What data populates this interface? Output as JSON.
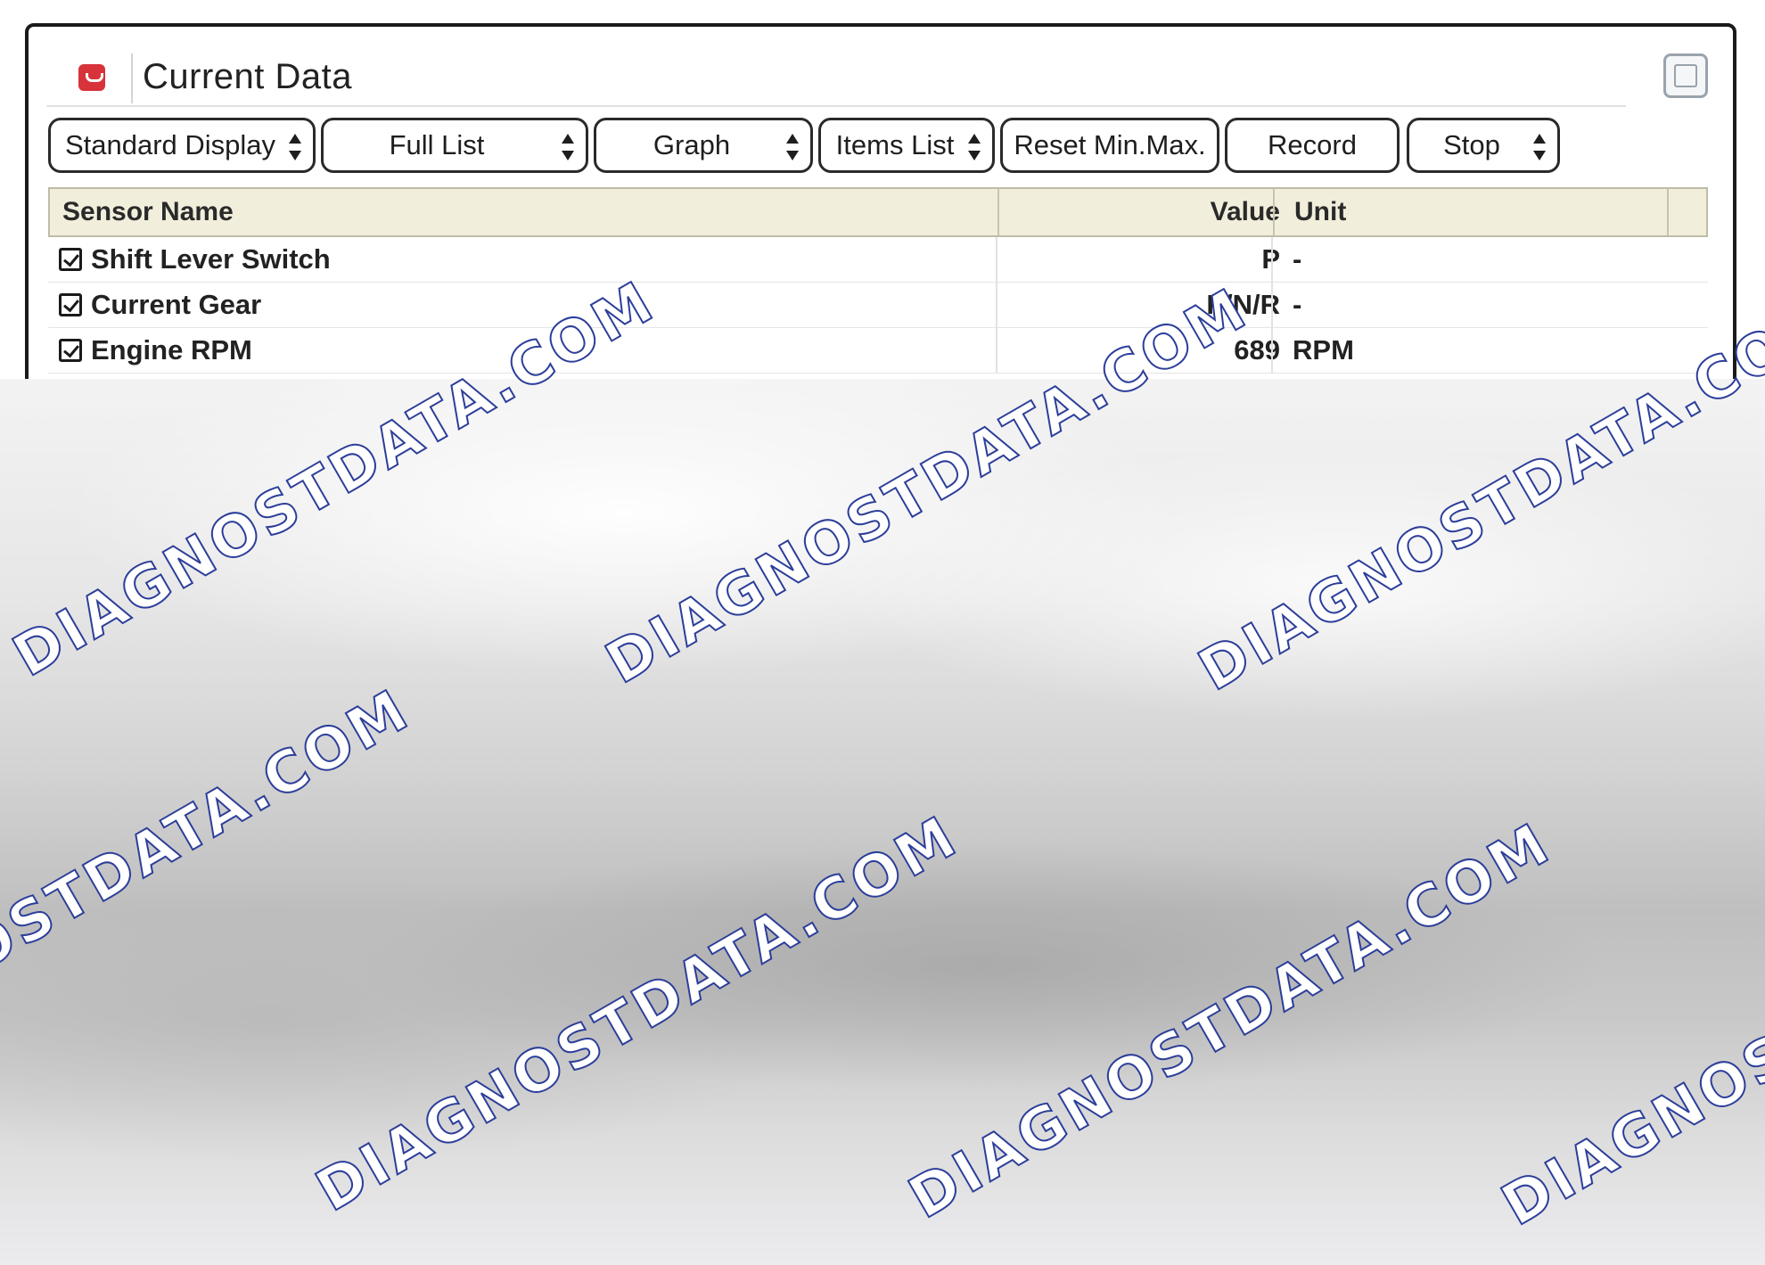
{
  "window": {
    "title": "Current Data",
    "icon": "app-logo-icon",
    "maximize_icon": "maximize-icon"
  },
  "toolbar": {
    "standard_display": "Standard Display",
    "full_list": "Full List",
    "graph": "Graph",
    "items_list": "Items List",
    "reset_min_max": "Reset Min.Max.",
    "record": "Record",
    "stop": "Stop"
  },
  "table": {
    "headers": {
      "sensor_name": "Sensor Name",
      "value": "Value",
      "unit": "Unit"
    },
    "rows": [
      {
        "checked": true,
        "name": "Shift Lever Switch",
        "value": "P",
        "unit": "-"
      },
      {
        "checked": true,
        "name": "Current Gear",
        "value": "P/N/R",
        "unit": "-"
      },
      {
        "checked": true,
        "name": "Engine RPM",
        "value": "689",
        "unit": "RPM"
      }
    ]
  },
  "watermark": {
    "text": "DIAGNOSTDATA.COM",
    "color_fill": "#ffffff",
    "color_stroke": "#2c3e9a"
  },
  "colors": {
    "header_bg": "#f1eedc",
    "icon_red": "#d8333a"
  }
}
